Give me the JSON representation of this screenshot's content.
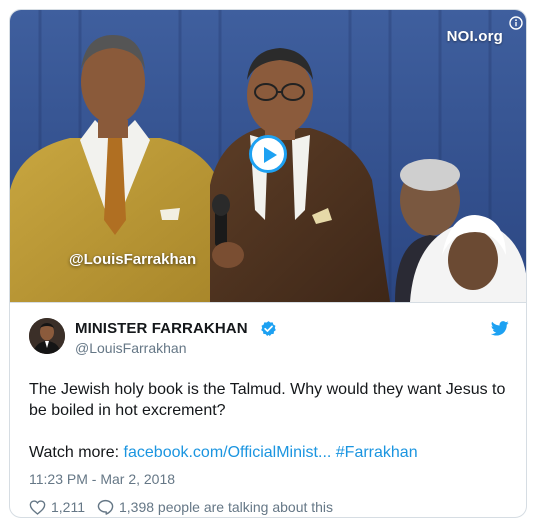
{
  "media": {
    "watermark": "NOI.org",
    "handle_overlay": "@LouisFarrakhan"
  },
  "author": {
    "display_name": "MINISTER FARRAKHAN",
    "username": "@LouisFarrakhan"
  },
  "tweet": {
    "text": "The Jewish holy book is the Talmud. Why would they want Jesus to be boiled in hot excrement?",
    "watch_more_prefix": "Watch more: ",
    "link_text": "facebook.com/OfficialMinist...",
    "hashtag": "#Farrakhan",
    "timestamp": "11:23 PM - Mar 2, 2018"
  },
  "engagement": {
    "likes": "1,211",
    "talking": "1,398 people are talking about this"
  },
  "colors": {
    "accent": "#1da1f2",
    "link": "#1b95e0",
    "secondary_text": "#657786"
  }
}
